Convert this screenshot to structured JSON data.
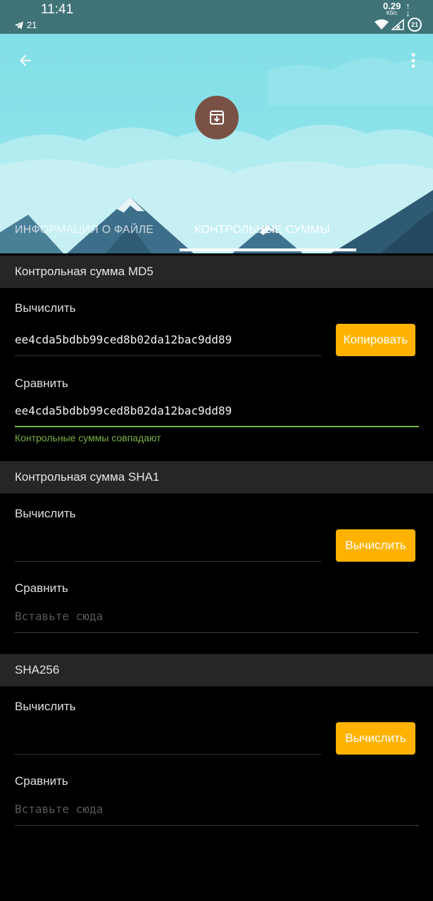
{
  "status_bar": {
    "time": "11:41",
    "telegram_count": "21",
    "net_speed": "0.29",
    "net_speed_unit": "Кб/с",
    "battery": "21"
  },
  "header": {
    "back_icon": "arrow-left-icon",
    "menu_icon": "more-vert-icon",
    "file_icon": "archive-icon",
    "avatar_color": "#7a5245"
  },
  "tabs": [
    {
      "label": "ИНФОРМАЦИЯ О ФАЙЛЕ",
      "active": false
    },
    {
      "label": "КОНТРОЛЬНЫЕ СУММЫ",
      "active": true
    }
  ],
  "sections": [
    {
      "title": "Контрольная сумма MD5",
      "calc_label": "Вычислить",
      "calc_value": "ee4cda5bdbb99ced8b02da12bac9dd89",
      "button_label": "Копировать",
      "compare_label": "Сравнить",
      "compare_value": "ee4cda5bdbb99ced8b02da12bac9dd89",
      "status": "Контрольные суммы совпадают"
    },
    {
      "title": "Контрольная сумма SHA1",
      "calc_label": "Вычислить",
      "calc_value": "",
      "button_label": "Вычислить",
      "compare_label": "Сравнить",
      "compare_placeholder": "Вставьте сюда"
    },
    {
      "title": "SHA256",
      "calc_label": "Вычислить",
      "calc_value": "",
      "button_label": "Вычислить",
      "compare_label": "Сравнить",
      "compare_placeholder": "Вставьте сюда"
    }
  ],
  "colors": {
    "accent_button": "#ffb300",
    "match_green": "#7cb342",
    "section_bg": "#262626"
  }
}
